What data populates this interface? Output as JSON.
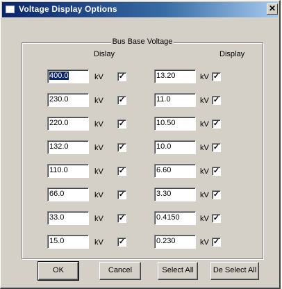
{
  "window": {
    "title": "Voltage Display Options"
  },
  "group": {
    "title": "Bus Base Voltage",
    "left_header": "Dislay",
    "right_header": "Display"
  },
  "left_rows": [
    {
      "value": "400.0",
      "unit": "kV",
      "checked": true,
      "selected": true
    },
    {
      "value": "230.0",
      "unit": "kV",
      "checked": true
    },
    {
      "value": "220.0",
      "unit": "kV",
      "checked": true
    },
    {
      "value": "132.0",
      "unit": "kV",
      "checked": true
    },
    {
      "value": "110.0",
      "unit": "kV",
      "checked": true
    },
    {
      "value": "66.0",
      "unit": "kV",
      "checked": true
    },
    {
      "value": "33.0",
      "unit": "kV",
      "checked": true
    },
    {
      "value": "15.0",
      "unit": "kV",
      "checked": true
    }
  ],
  "right_rows": [
    {
      "value": "13.20",
      "unit": "kV",
      "checked": true
    },
    {
      "value": "11.0",
      "unit": "kV",
      "checked": true
    },
    {
      "value": "10.50",
      "unit": "kV",
      "checked": true
    },
    {
      "value": "10.0",
      "unit": "kV",
      "checked": true
    },
    {
      "value": "6.60",
      "unit": "kV",
      "checked": true
    },
    {
      "value": "3.30",
      "unit": "kV",
      "checked": true
    },
    {
      "value": "0.4150",
      "unit": "kV",
      "checked": true
    },
    {
      "value": "0.230",
      "unit": "kV",
      "checked": true
    }
  ],
  "buttons": {
    "ok": "OK",
    "cancel": "Cancel",
    "select_all": "Select All",
    "deselect_all": "De Select All"
  },
  "glyphs": {
    "check": "✓",
    "close": "✕"
  }
}
